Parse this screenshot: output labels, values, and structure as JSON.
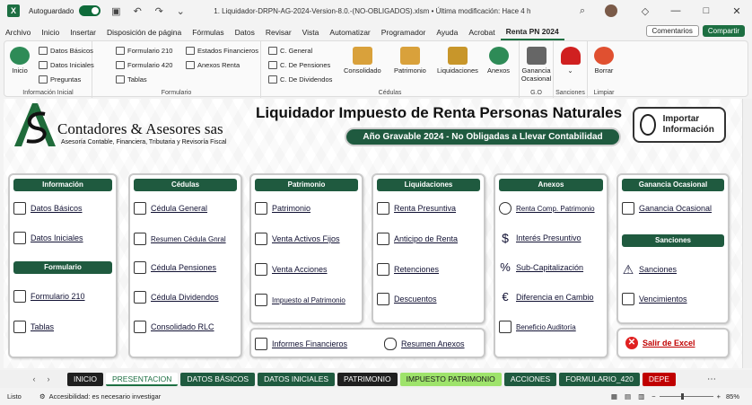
{
  "titlebar": {
    "autosave_label": "Autoguardado",
    "doc_title": "1. Liquidador-DRPN-AG-2024-Version-8.0.-(NO-OBLIGADOS).xlsm  •  Última modificación: Hace 4 h"
  },
  "menu": {
    "tabs": [
      "Archivo",
      "Inicio",
      "Insertar",
      "Disposición de página",
      "Fórmulas",
      "Datos",
      "Revisar",
      "Vista",
      "Automatizar",
      "Programador",
      "Ayuda",
      "Acrobat",
      "Renta PN 2024"
    ],
    "active": "Renta PN 2024",
    "comments": "Comentarios",
    "share": "Compartir"
  },
  "ribbon": {
    "inicio": "Inicio",
    "datos_basicos": "Datos Básicos",
    "datos_iniciales": "Datos Iniciales",
    "preguntas": "Preguntas",
    "group_info": "Información Inicial",
    "formulario_210": "Formulario 210",
    "formulario_420": "Formulario 420",
    "tablas": "Tablas",
    "estados_financieros": "Estados Financieros",
    "anexos_renta": "Anexos Renta",
    "group_formulario": "Formulario",
    "c_general": "C. General",
    "c_pensiones": "C. De Pensiones",
    "c_dividendos": "C. De Dividendos",
    "group_cedulas": "Cédulas",
    "consolidado": "Consolidado",
    "patrimonio": "Patrimonio",
    "liquidaciones": "Liquidaciones",
    "anexos": "Anexos",
    "ganancia_ocasional": "Ganancia Ocasional",
    "group_go": "G.O",
    "group_sanciones": "Sanciones",
    "borrar": "Borrar",
    "group_limpiar": "Limpiar"
  },
  "header": {
    "logo_name": "Contadores & Asesores sas",
    "logo_sub": "Asesoría Contable, Financiera, Tributaria y Revisoría Fiscal",
    "title": "Liquidador Impuesto de Renta Personas Naturales",
    "subtitle": "Año Gravable 2024 - No Obligadas a Llevar Contabilidad",
    "import_button": "Importar Información"
  },
  "cards": {
    "informacion": {
      "title": "Información",
      "items": [
        "Datos Básicos",
        "Datos Iniciales"
      ]
    },
    "formulario": {
      "title": "Formulario",
      "items": [
        "Formulario 210",
        "Tablas"
      ]
    },
    "cedulas": {
      "title": "Cédulas",
      "items": [
        "Cédula General",
        "Resumen Cédula Gnral",
        "Cédula Pensiones",
        "Cédula Dividendos",
        "Consolidado RLC"
      ]
    },
    "patrimonio": {
      "title": "Patrimonio",
      "items": [
        "Patrimonio",
        "Venta Activos Fijos",
        "Venta Acciones",
        "Impuesto al Patrimonio"
      ]
    },
    "liquidaciones": {
      "title": "Liquidaciones",
      "items": [
        "Renta Presuntiva",
        "Anticipo de Renta",
        "Retenciones",
        "Descuentos"
      ]
    },
    "anexos": {
      "title": "Anexos",
      "items": [
        "Renta Comp. Patrimonio",
        "Interés Presuntivo",
        "Sub-Capitalización",
        "Diferencia en Cambio",
        "Beneficio Auditoría"
      ]
    },
    "ganancia": {
      "title": "Ganancia Ocasional",
      "items": [
        "Ganancia Ocasional"
      ]
    },
    "sanciones": {
      "title": "Sanciones",
      "items": [
        "Sanciones",
        "Vencimientos"
      ]
    },
    "informes": {
      "items": [
        "Informes Financieros",
        "Resumen Anexos"
      ]
    },
    "salir": "Salir de Excel"
  },
  "sheet_tabs": [
    {
      "label": "INICIO",
      "bg": "#1f1f1f",
      "fg": "#ffffff"
    },
    {
      "label": "PRESENTACION",
      "bg": "#ffffff",
      "fg": "#1d6f42"
    },
    {
      "label": "DATOS BÁSICOS",
      "bg": "#1f5a3f",
      "fg": "#ffffff"
    },
    {
      "label": "DATOS INICIALES",
      "bg": "#1f5a3f",
      "fg": "#ffffff"
    },
    {
      "label": "PATRIMONIO",
      "bg": "#1f1f1f",
      "fg": "#ffffff"
    },
    {
      "label": "IMPUESTO PATRIMONIO",
      "bg": "#9ee36b",
      "fg": "#1a1a1a"
    },
    {
      "label": "ACCIONES",
      "bg": "#1f5a3f",
      "fg": "#ffffff"
    },
    {
      "label": "FORMULARIO_420",
      "bg": "#1f5a3f",
      "fg": "#ffffff"
    },
    {
      "label": "DEPE",
      "bg": "#c00000",
      "fg": "#ffffff"
    }
  ],
  "status": {
    "ready": "Listo",
    "accessibility": "Accesibilidad: es necesario investigar",
    "zoom": "85%"
  },
  "colors": {
    "brand_green": "#1f5a3f",
    "excel_green": "#1d6f42",
    "exit_red": "#e02020"
  }
}
